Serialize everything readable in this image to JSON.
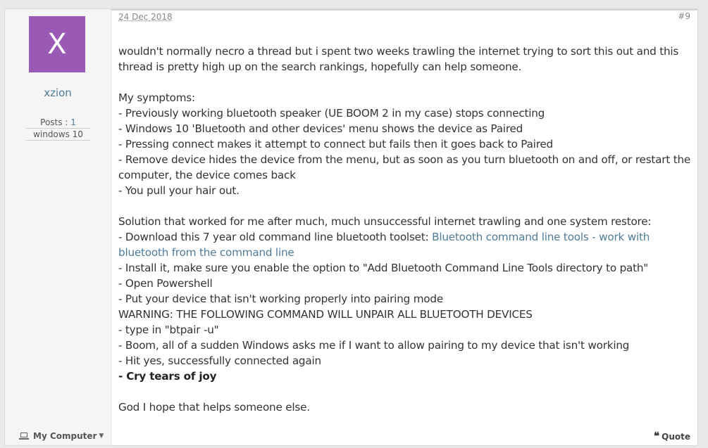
{
  "user": {
    "avatar_letter": "X",
    "avatar_color": "#9b59b6",
    "username": "xzion",
    "posts_label": "Posts : ",
    "posts_count": "1",
    "os": "windows 10",
    "my_computer_label": "My Computer"
  },
  "post": {
    "date": "24 Dec 2018",
    "number": "#9",
    "lines": {
      "l1": "wouldn't normally necro a thread but i spent two weeks trawling the internet trying to sort this out and this thread is pretty high up on the search rankings, hopefully can help someone.",
      "l2": "My symptoms:",
      "l3": "- Previously working bluetooth speaker (UE BOOM 2 in my case) stops connecting",
      "l4": "- Windows 10 'Bluetooth and other devices' menu shows the device as Paired",
      "l5": "- Pressing connect makes it attempt to connect but fails then it goes back to Paired",
      "l6": "- Remove device hides the device from the menu, but as soon as you turn bluetooth on and off, or restart the computer, the device comes back",
      "l7": "- You pull your hair out.",
      "l8": "Solution that worked for me after much, much unsuccessful internet trawling and one system restore:",
      "l9_prefix": "- Download this 7 year old command line bluetooth toolset: ",
      "l9_link": "Bluetooth command line tools - work with bluetooth from the command line",
      "l10": "- Install it, make sure you enable the option to \"Add Bluetooth Command Line Tools directory to path\"",
      "l11": "- Open Powershell",
      "l12": "- Put your device that isn't working properly into pairing mode",
      "l13": "WARNING: THE FOLLOWING COMMAND WILL UNPAIR ALL BLUETOOTH DEVICES",
      "l14": "- type in \"btpair -u\"",
      "l15": "- Boom, all of a sudden Windows asks me if I want to allow pairing to my device that isn't working",
      "l16": "- Hit yes, successfully connected again",
      "l17": "- Cry tears of joy",
      "l18": "God I hope that helps someone else."
    },
    "quote_label": "Quote"
  },
  "colors": {
    "link": "#4f7c9a",
    "text": "#333333"
  }
}
